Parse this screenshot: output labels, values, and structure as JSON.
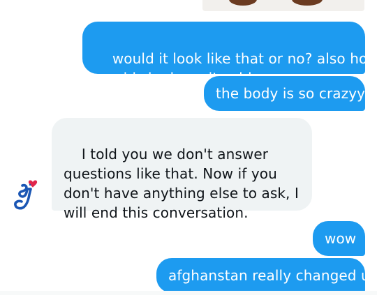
{
  "conversation": {
    "messages": [
      {
        "direction": "outgoing",
        "text": "would it look like that or no? also how\nwould she keep it cold"
      },
      {
        "direction": "outgoing",
        "text": "the body is so crazyy"
      },
      {
        "direction": "incoming",
        "text": "I told you we don't answer\nquestions like that. Now if you\ndon't have anything else to ask, I\nwill end this conversation."
      },
      {
        "direction": "outgoing",
        "text": "wow"
      },
      {
        "direction": "outgoing",
        "text": "afghanstan really changed u"
      }
    ],
    "avatar_icon": "general-mills-logo-icon"
  },
  "colors": {
    "outgoing_bubble": "#1d9bf0",
    "incoming_bubble": "#eff3f4",
    "incoming_text": "#0f1419",
    "outgoing_text": "#ffffff",
    "logo_blue": "#1a56b4",
    "logo_heart": "#e0254b"
  }
}
